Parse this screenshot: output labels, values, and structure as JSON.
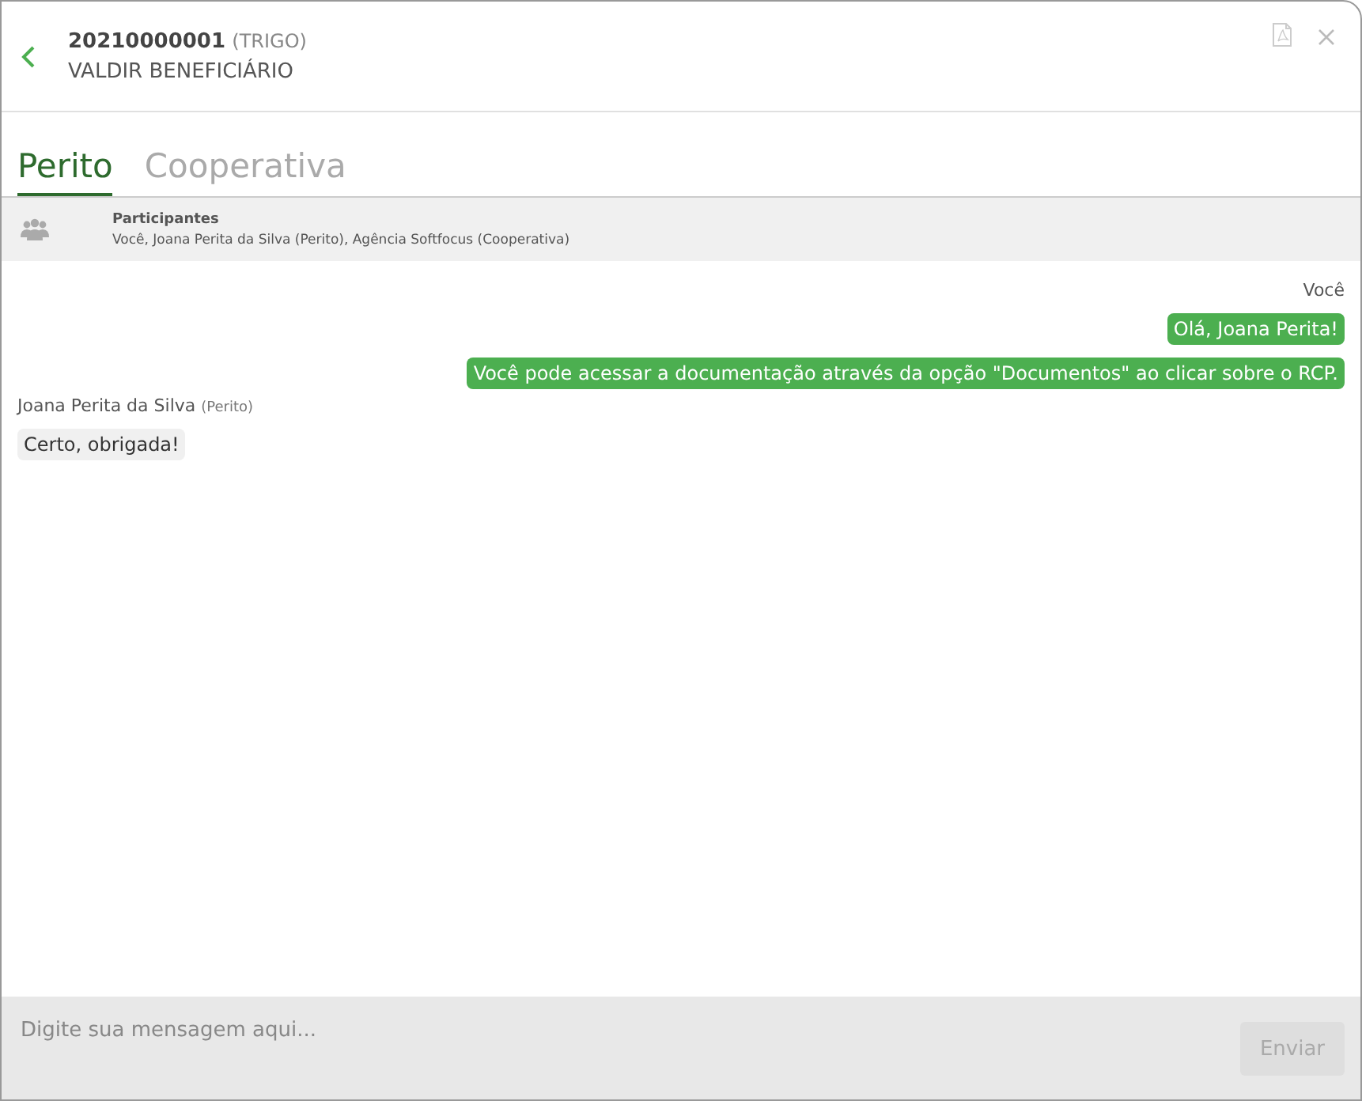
{
  "header": {
    "code": "20210000001",
    "crop": "(TRIGO)",
    "name": "VALDIR BENEFICIÁRIO"
  },
  "tabs": [
    {
      "label": "Perito",
      "selected": true
    },
    {
      "label": "Cooperativa",
      "selected": false
    }
  ],
  "participants": {
    "label": "Participantes",
    "names": "Você, Joana Perita da Silva (Perito), Agência Softfocus (Cooperativa)"
  },
  "groups": [
    {
      "kind": "sent",
      "sender": "Você",
      "messages": [
        "Olá, Joana Perita!",
        "Você pode acessar a documentação através da opção \"Documentos\" ao clicar sobre o RCP."
      ]
    },
    {
      "kind": "received",
      "sender": "Joana Perita da Silva",
      "role": "(Perito)",
      "messages": [
        "Certo, obrigada!"
      ]
    }
  ],
  "composer": {
    "placeholder": "Digite sua mensagem aqui...",
    "send_label": "Enviar",
    "send_disabled": true
  }
}
